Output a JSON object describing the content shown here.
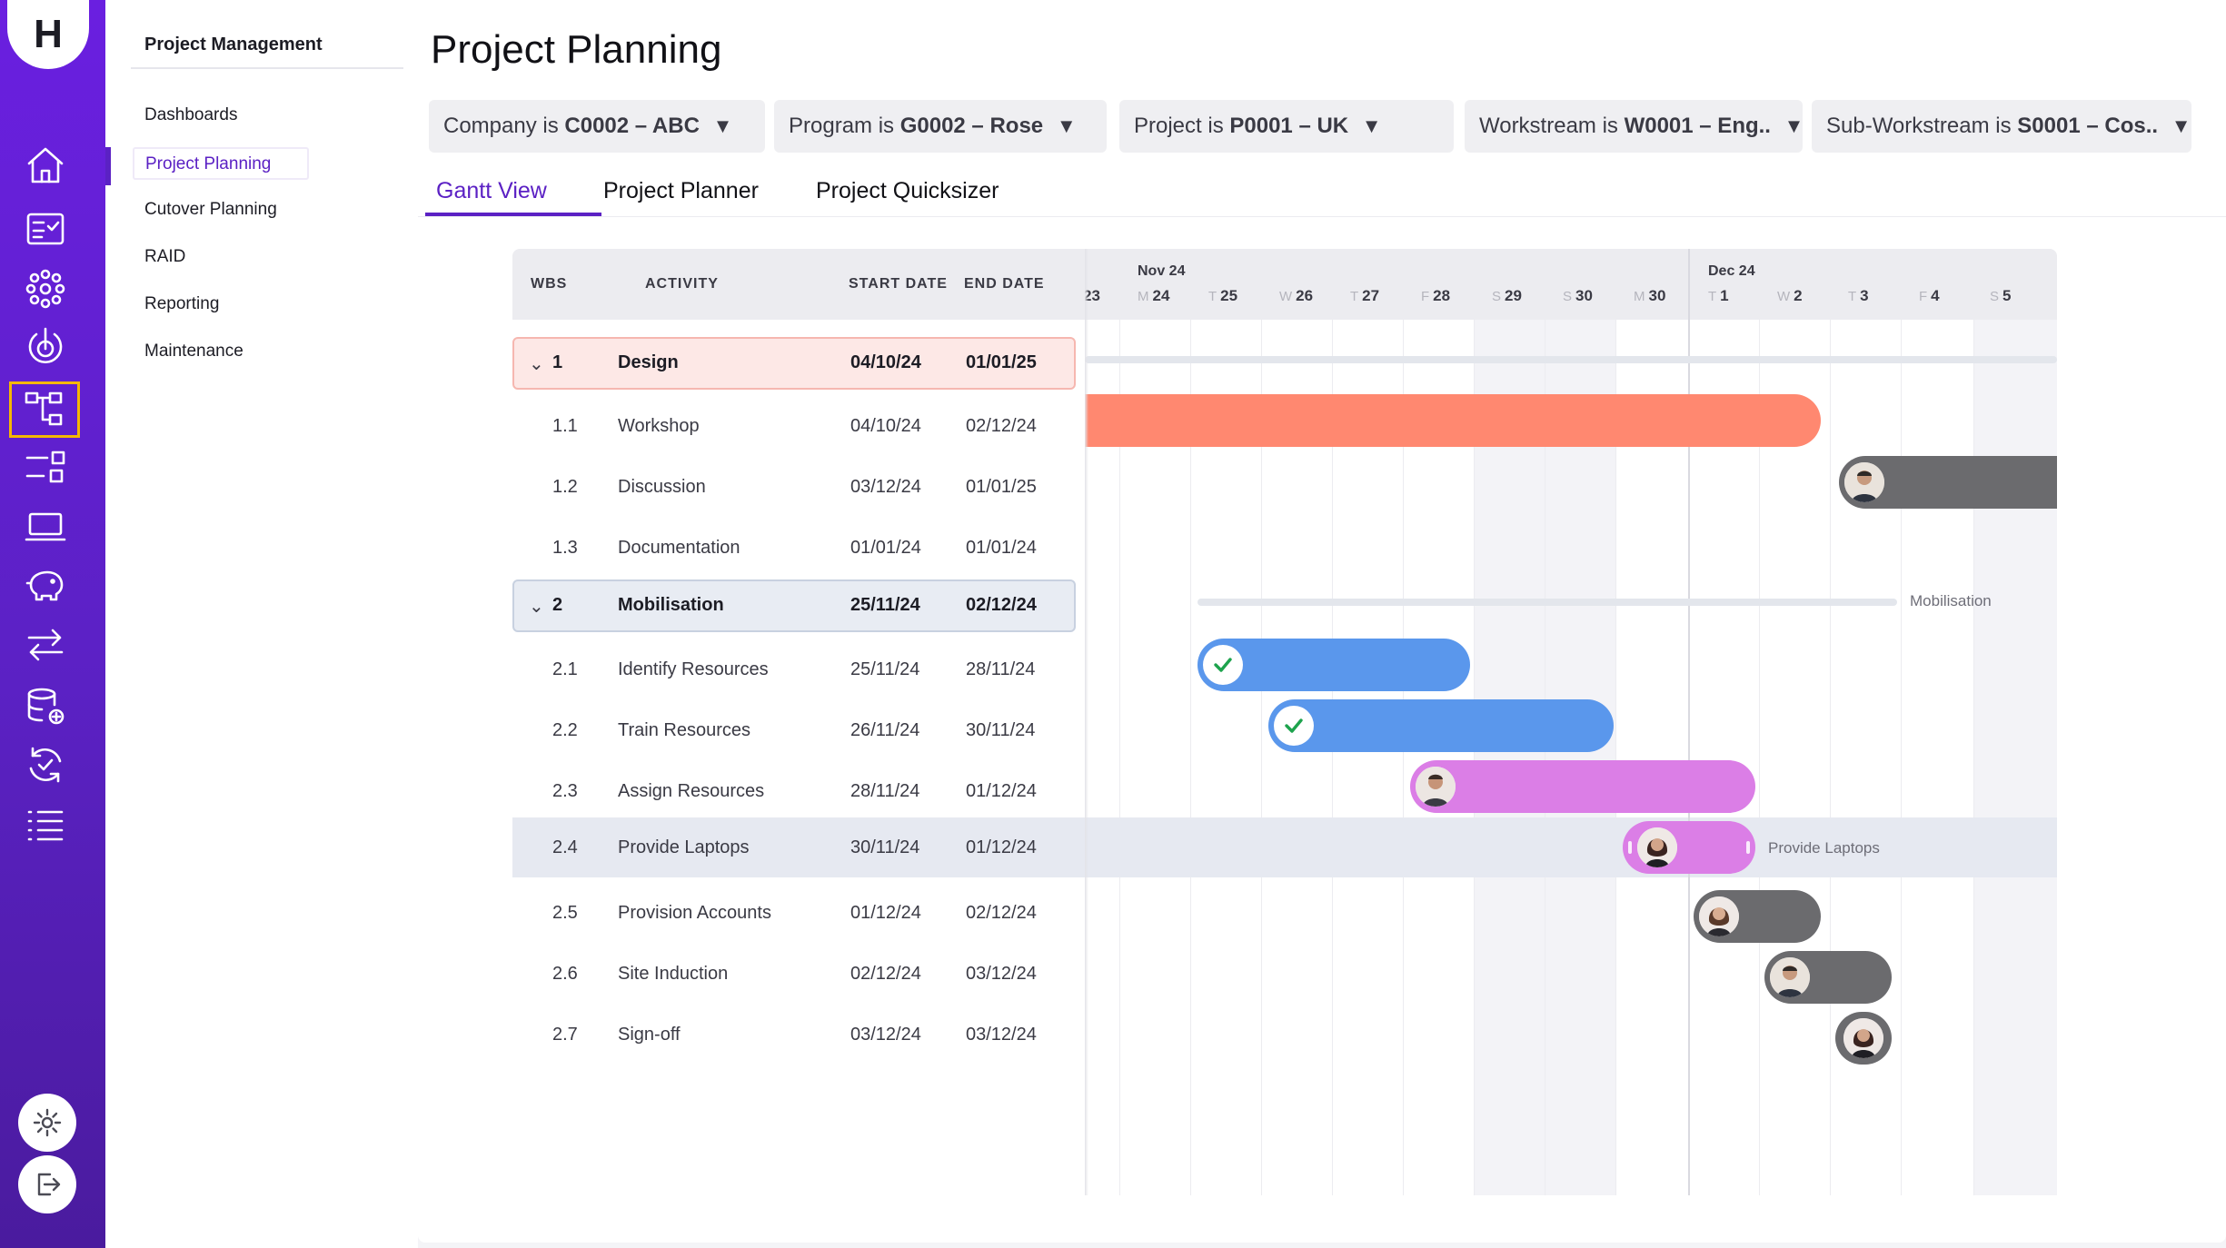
{
  "app": {
    "logo_letter": "H"
  },
  "rail": {
    "icons": [
      "home-icon",
      "task-list-icon",
      "network-icon",
      "target-icon",
      "hierarchy-icon",
      "workflow-icon",
      "laptop-icon",
      "piggy-bank-icon",
      "transfer-icon",
      "database-add-icon",
      "sync-check-icon",
      "list-icon"
    ],
    "bottom_icons": [
      "gear-icon",
      "logout-icon"
    ],
    "accent": "#5b21c4",
    "active_outline": "#f5b700"
  },
  "subnav": {
    "title": "Project Management",
    "items": [
      "Dashboards",
      "Project Planning",
      "Cutover Planning",
      "RAID",
      "Reporting",
      "Maintenance"
    ],
    "active": "Project Planning"
  },
  "page": {
    "title": "Project Planning"
  },
  "filters": [
    {
      "label": "Company is",
      "value": "C0002 – ABC"
    },
    {
      "label": "Program is",
      "value": "G0002 – Rose"
    },
    {
      "label": "Project is",
      "value": "P0001 – UK"
    },
    {
      "label": "Workstream is",
      "value": "W0001 – Eng.."
    },
    {
      "label": "Sub-Workstream is",
      "value": "S0001 – Cos.."
    }
  ],
  "tabs": [
    "Gantt View",
    "Project Planner",
    "Project Quicksizer"
  ],
  "active_tab": "Gantt View",
  "table": {
    "headers": {
      "wbs": "WBS",
      "activity": "ACTIVITY",
      "start": "START DATE",
      "end": "END DATE"
    },
    "rows": [
      {
        "wbs": "1",
        "activity": "Design",
        "start": "04/10/24",
        "end": "01/01/25"
      },
      {
        "wbs": "1.1",
        "activity": "Workshop",
        "start": "04/10/24",
        "end": "02/12/24"
      },
      {
        "wbs": "1.2",
        "activity": "Discussion",
        "start": "03/12/24",
        "end": "01/01/25"
      },
      {
        "wbs": "1.3",
        "activity": "Documentation",
        "start": "01/01/24",
        "end": "01/01/24"
      },
      {
        "wbs": "2",
        "activity": "Mobilisation",
        "start": "25/11/24",
        "end": "02/12/24"
      },
      {
        "wbs": "2.1",
        "activity": "Identify Resources",
        "start": "25/11/24",
        "end": "28/11/24"
      },
      {
        "wbs": "2.2",
        "activity": "Train Resources",
        "start": "26/11/24",
        "end": "30/11/24"
      },
      {
        "wbs": "2.3",
        "activity": "Assign Resources",
        "start": "28/11/24",
        "end": "01/12/24"
      },
      {
        "wbs": "2.4",
        "activity": "Provide Laptops",
        "start": "30/11/24",
        "end": "01/12/24"
      },
      {
        "wbs": "2.5",
        "activity": "Provision Accounts",
        "start": "01/12/24",
        "end": "02/12/24"
      },
      {
        "wbs": "2.6",
        "activity": "Site Induction",
        "start": "02/12/24",
        "end": "03/12/24"
      },
      {
        "wbs": "2.7",
        "activity": "Sign-off",
        "start": "03/12/24",
        "end": "03/12/24"
      }
    ]
  },
  "timeline": {
    "months": [
      "Nov 24",
      "Dec 24"
    ],
    "days": [
      {
        "dow": "",
        "num": "23"
      },
      {
        "dow": "M",
        "num": "24"
      },
      {
        "dow": "T",
        "num": "25"
      },
      {
        "dow": "W",
        "num": "26"
      },
      {
        "dow": "T",
        "num": "27"
      },
      {
        "dow": "F",
        "num": "28"
      },
      {
        "dow": "S",
        "num": "29"
      },
      {
        "dow": "S",
        "num": "30"
      },
      {
        "dow": "M",
        "num": "30"
      },
      {
        "dow": "T",
        "num": "1"
      },
      {
        "dow": "W",
        "num": "2"
      },
      {
        "dow": "T",
        "num": "3"
      },
      {
        "dow": "F",
        "num": "4"
      },
      {
        "dow": "S",
        "num": "5"
      }
    ],
    "bar_labels": {
      "mobilisation": "Mobilisation",
      "provide_laptops": "Provide Laptops"
    },
    "colors": {
      "orange": "#ff8870",
      "dark": "#6b6b6e",
      "blue": "#5a97ec",
      "pink": "#db7ee6"
    }
  }
}
